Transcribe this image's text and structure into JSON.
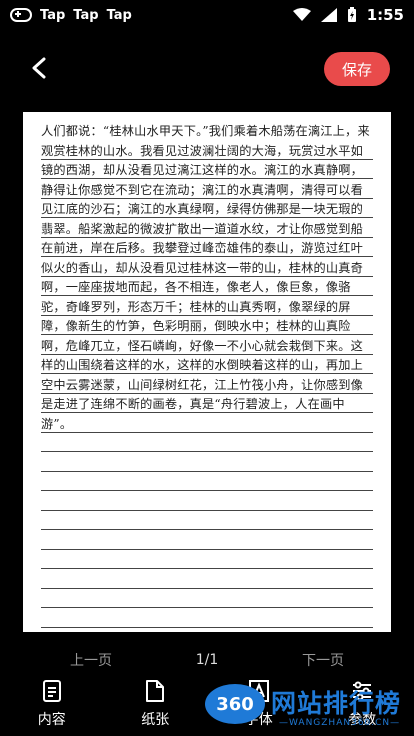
{
  "status": {
    "left_items": [
      "Tap",
      "Tap",
      "Tap"
    ],
    "time": "1:55"
  },
  "header": {
    "save_label": "保存"
  },
  "document": {
    "text": "人们都说：“桂林山水甲天下。”我们乘着木船荡在漓江上，来观赏桂林的山水。我看见过波澜壮阔的大海，玩赏过水平如镜的西湖，却从没看见过漓江这样的水。漓江的水真静啊，静得让你感觉不到它在流动；漓江的水真清啊，清得可以看见江底的沙石；漓江的水真绿啊，绿得仿佛那是一块无瑕的翡翠。船桨激起的微波扩散出一道道水纹，才让你感觉到船在前进，岸在后移。我攀登过峰峦雄伟的泰山，游览过红叶似火的香山，却从没看见过桂林这一带的山，桂林的山真奇啊，一座座拔地而起，各不相连，像老人，像巨象，像骆驼，奇峰罗列，形态万千；桂林的山真秀啊，像翠绿的屏障，像新生的竹笋，色彩明丽，倒映水中；桂林的山真险啊，危峰兀立，怪石嶙峋，好像一不小心就会栽倒下来。这样的山围绕着这样的水，这样的水倒映着这样的山，再加上空中云雾迷蒙，山间绿树红花，江上竹筏小舟，让你感到像是走进了连绵不断的画卷，真是“舟行碧波上，人在画中游”。",
    "line_count": 25
  },
  "pagination": {
    "prev": "上一页",
    "current": "1/1",
    "next": "下一页"
  },
  "toolbar": [
    {
      "label": "内容",
      "icon": "document-icon"
    },
    {
      "label": "纸张",
      "icon": "paper-icon"
    },
    {
      "label": "字体",
      "icon": "font-icon"
    },
    {
      "label": "参数",
      "icon": "sliders-icon"
    }
  ],
  "watermark": {
    "badge": "360",
    "name": "网站排行榜",
    "site": "—WANGZHAN360.CN—"
  }
}
